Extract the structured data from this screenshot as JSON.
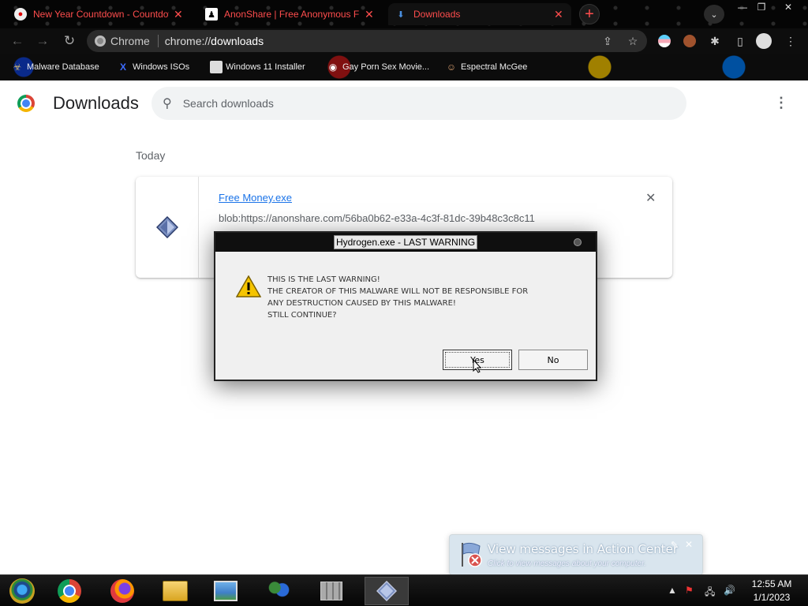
{
  "browser": {
    "tabs": [
      {
        "title": "New Year Countdown - Countdown",
        "active": false
      },
      {
        "title": "AnonShare | Free Anonymous File",
        "active": false
      },
      {
        "title": "Downloads",
        "active": true
      }
    ],
    "new_tab": "+",
    "omnibox": {
      "site_label": "Chrome",
      "url_prefix": "chrome://",
      "url_host": "downloads"
    },
    "bookmarks": [
      "Malware Database",
      "Windows ISOs",
      "Windows 11 Installer",
      "Gay Porn Sex Movie...",
      "Espectral McGee"
    ]
  },
  "downloads": {
    "title": "Downloads",
    "search_placeholder": "Search downloads",
    "section": "Today",
    "item": {
      "filename": "Free Money.exe",
      "url": "blob:https://anonshare.com/56ba0b62-e33a-4c3f-81dc-39b48c3c8c11"
    }
  },
  "dialog": {
    "title": "Hydrogen.exe - LAST WARNING",
    "message": "THIS IS THE LAST WARNING!\nTHE CREATOR OF THIS MALWARE WILL NOT BE RESPONSIBLE FOR\nANY DESTRUCTION CAUSED BY THIS MALWARE!\nSTILL CONTINUE?",
    "yes": "Yes",
    "no": "No"
  },
  "notification": {
    "title": "View messages in Action Center",
    "subtitle": "Click to view messages about your computer."
  },
  "taskbar": {
    "time": "12:55 AM",
    "date": "1/1/2023"
  },
  "colors": {
    "link": "#1a73e8",
    "tab_text": "#ff4d4d"
  }
}
